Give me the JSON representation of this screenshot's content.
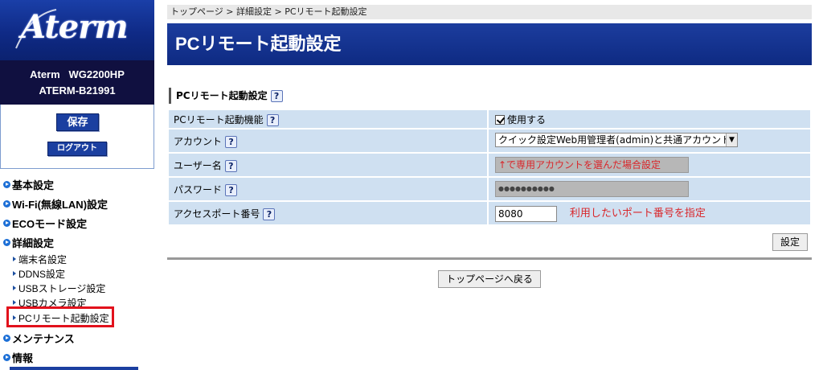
{
  "sidebar": {
    "logo_text": "Aterm",
    "device_model": "Aterm   WG2200HP",
    "device_id": "ATERM-B21991",
    "save_label": "保存",
    "logout_label": "ログアウト",
    "nav": {
      "basic": "基本設定",
      "wifi": "Wi-Fi(無線LAN)設定",
      "eco": "ECOモード設定",
      "advanced": "詳細設定",
      "sub": {
        "terminal_name": "端末名設定",
        "ddns": "DDNS設定",
        "usb_storage": "USBストレージ設定",
        "usb_camera": "USBカメラ設定",
        "pc_remote": "PCリモート起動設定"
      },
      "maintenance": "メンテナンス",
      "info": "情報"
    }
  },
  "main": {
    "breadcrumb": "トップページ > 詳細設定 > PCリモート起動設定",
    "page_title": "PCリモート起動設定",
    "section_title": "PCリモート起動設定",
    "help_glyph": "?",
    "rows": {
      "function_label": "PCリモート起動機能",
      "function_value": "使用する",
      "account_label": "アカウント",
      "account_value": "クイック設定Web用管理者(admin)と共通アカウント",
      "username_label": "ユーザー名",
      "username_note": "↑で専用アカウントを選んだ場合設定",
      "password_label": "パスワード",
      "password_value": "●●●●●●●●●●",
      "port_label": "アクセスポート番号",
      "port_value": "8080",
      "port_note": "利用したいポート番号を指定"
    },
    "set_label": "設定",
    "back_label": "トップページへ戻る"
  },
  "colors": {
    "brand_blue": "#1b3fa0",
    "table_bg": "#cfe0f1",
    "annotation_red": "#d9262a",
    "highlight_red": "#e2111c"
  }
}
